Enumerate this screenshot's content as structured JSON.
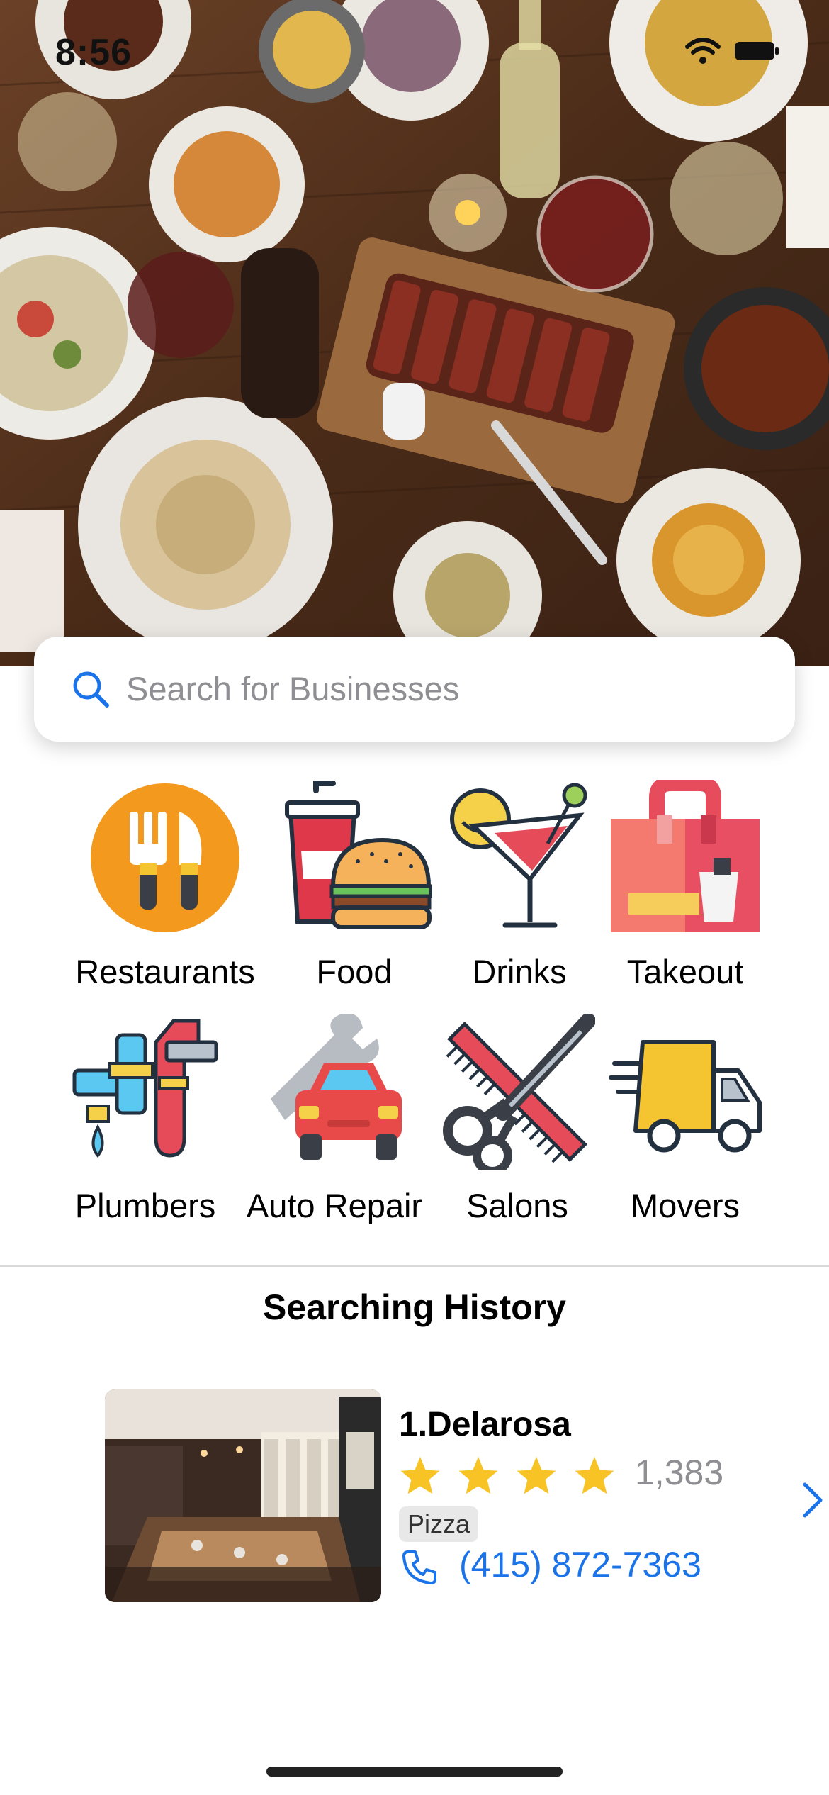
{
  "status_bar": {
    "time": "8:56"
  },
  "search": {
    "placeholder": "Search for Businesses"
  },
  "categories": [
    {
      "label": "Restaurants",
      "icon": "fork-knife-icon"
    },
    {
      "label": "Food",
      "icon": "burger-drink-icon"
    },
    {
      "label": "Drinks",
      "icon": "cocktail-icon"
    },
    {
      "label": "Takeout",
      "icon": "takeout-bag-icon"
    },
    {
      "label": "Plumbers",
      "icon": "pipe-wrench-icon"
    },
    {
      "label": "Auto Repair",
      "icon": "car-wrench-icon"
    },
    {
      "label": "Salons",
      "icon": "scissors-comb-icon"
    },
    {
      "label": "Movers",
      "icon": "moving-truck-icon"
    }
  ],
  "history": {
    "title": "Searching History",
    "items": [
      {
        "name": "1.Delarosa",
        "rating": 4,
        "review_count": "1,383",
        "tag": "Pizza",
        "phone": "(415) 872-7363"
      }
    ]
  },
  "colors": {
    "accent": "#1a73e8",
    "star": "#f7c325",
    "placeholder": "#8e8e93"
  }
}
